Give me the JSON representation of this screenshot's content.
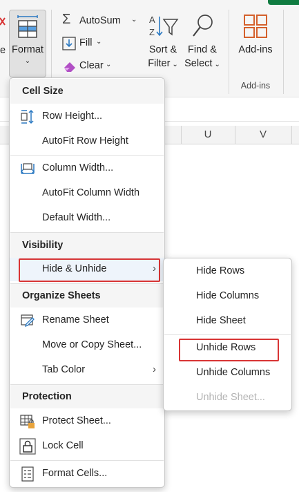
{
  "ribbon": {
    "format_label": "Format",
    "autosum_label": "AutoSum",
    "fill_label": "Fill",
    "clear_label": "Clear",
    "sort_filter_line1": "Sort &",
    "sort_filter_line2": "Filter",
    "find_select_line1": "Find &",
    "find_select_line2": "Select",
    "addins_label": "Add-ins",
    "addins_group_label": "Add-ins"
  },
  "columns": [
    "U",
    "V"
  ],
  "format_menu": {
    "sections": {
      "cell_size": "Cell Size",
      "visibility": "Visibility",
      "organize": "Organize Sheets",
      "protection": "Protection"
    },
    "items": {
      "row_height": "Row Height...",
      "autofit_row": "AutoFit Row Height",
      "column_width": "Column Width...",
      "autofit_column": "AutoFit Column Width",
      "default_width": "Default Width...",
      "hide_unhide": "Hide & Unhide",
      "rename_sheet": "Rename Sheet",
      "move_copy": "Move or Copy Sheet...",
      "tab_color": "Tab Color",
      "protect_sheet": "Protect Sheet...",
      "lock_cell": "Lock Cell",
      "format_cells": "Format Cells..."
    }
  },
  "hide_unhide_submenu": {
    "items": [
      "Hide Rows",
      "Hide Columns",
      "Hide Sheet",
      "Unhide Rows",
      "Unhide Columns",
      "Unhide Sheet..."
    ],
    "disabled": [
      "Unhide Sheet..."
    ],
    "highlighted": "Unhide Rows"
  },
  "colors": {
    "highlight_box": "#d83434",
    "icon_blue": "#2b79c2",
    "addins_orange": "#d4602c",
    "excel_green": "#107c41"
  }
}
